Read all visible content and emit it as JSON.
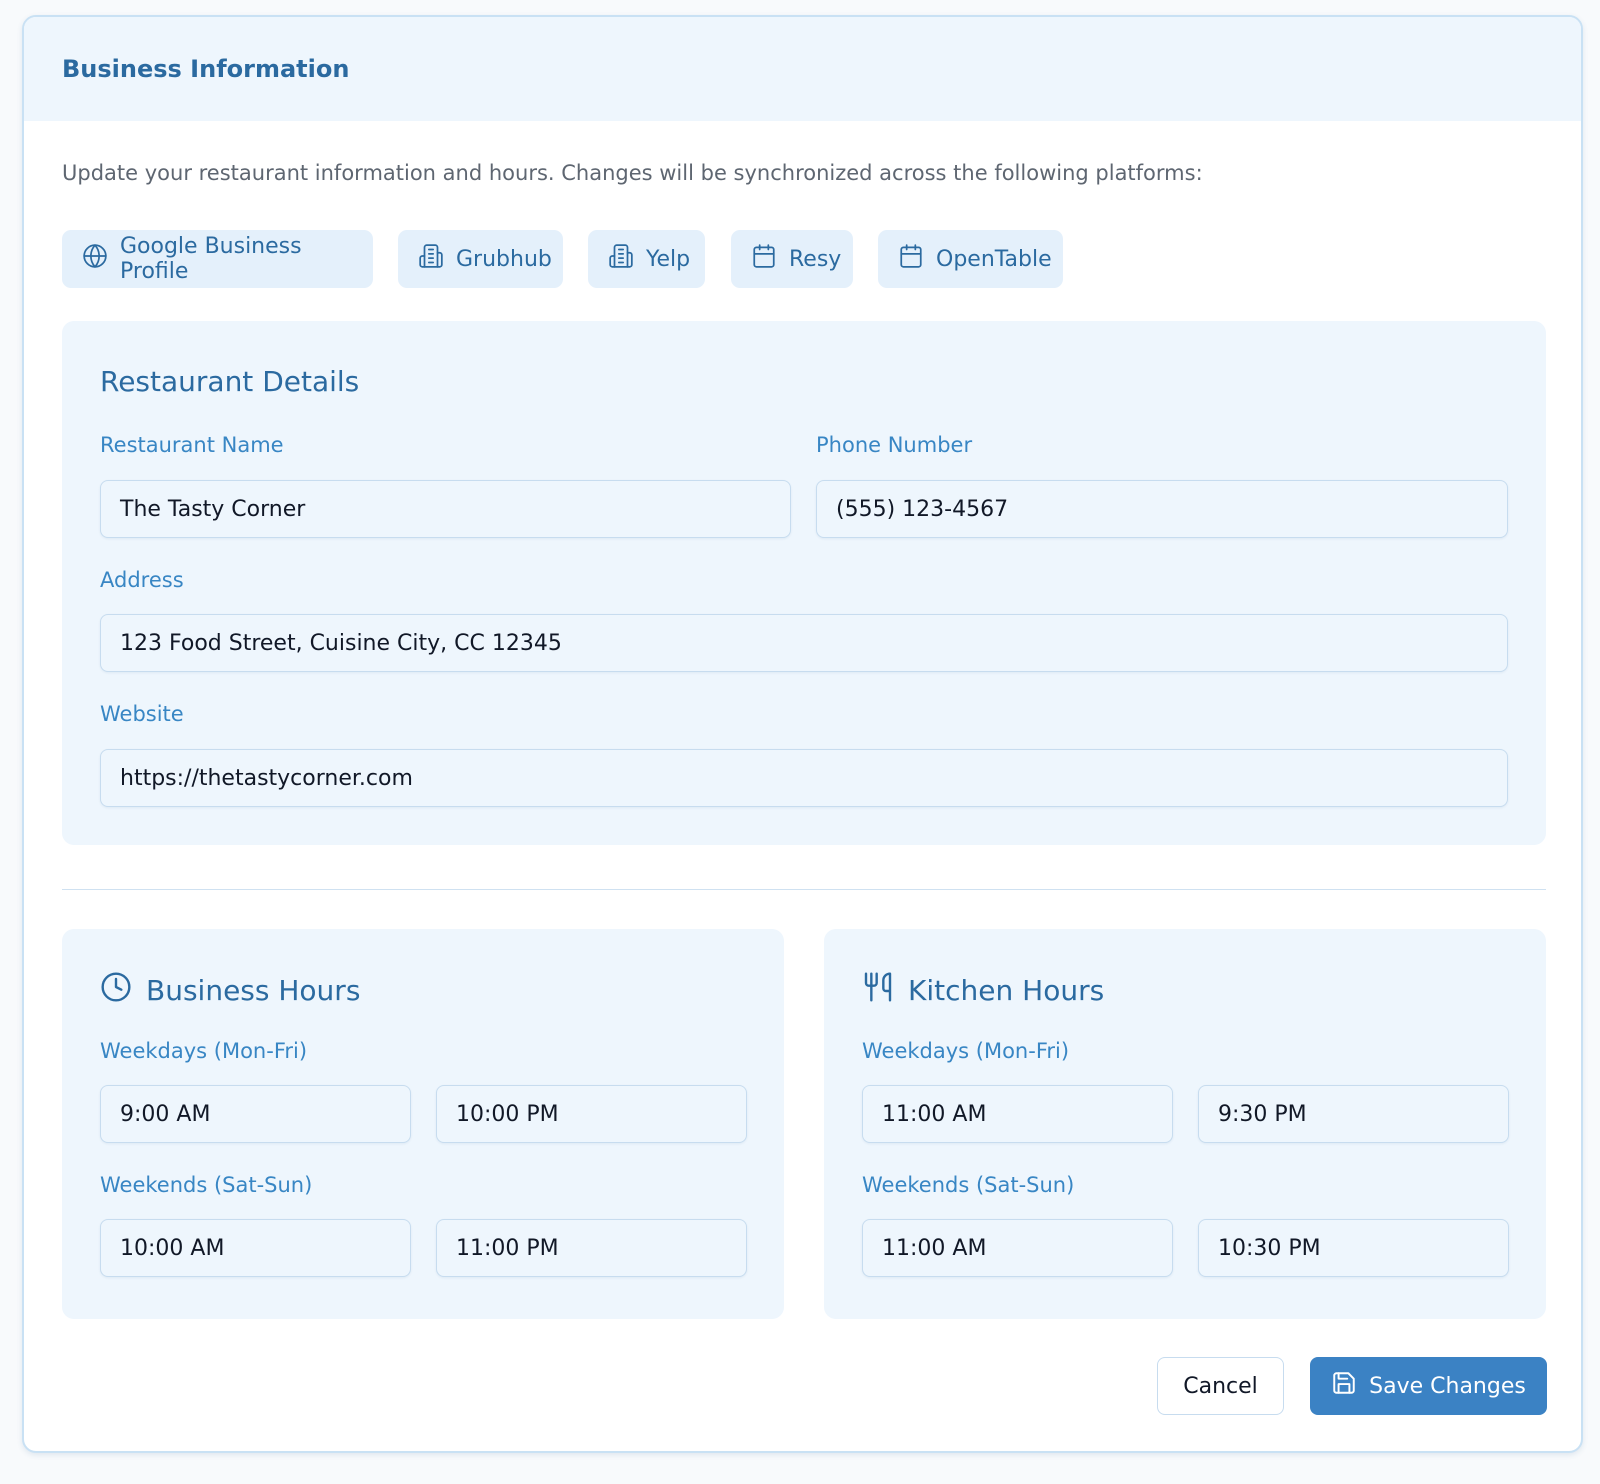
{
  "header": {
    "title": "Business Information"
  },
  "intro": "Update your restaurant information and hours. Changes will be synchronized across the following platforms:",
  "platforms": [
    {
      "label": "Google Business Profile",
      "icon": "globe-icon"
    },
    {
      "label": "Grubhub",
      "icon": "building-icon"
    },
    {
      "label": "Yelp",
      "icon": "building-icon"
    },
    {
      "label": "Resy",
      "icon": "calendar-icon"
    },
    {
      "label": "OpenTable",
      "icon": "calendar-icon"
    }
  ],
  "details": {
    "title": "Restaurant Details",
    "name_label": "Restaurant Name",
    "name_value": "The Tasty Corner",
    "phone_label": "Phone Number",
    "phone_value": "(555) 123-4567",
    "address_label": "Address",
    "address_value": "123 Food Street, Cuisine City, CC 12345",
    "website_label": "Website",
    "website_value": "https://thetastycorner.com"
  },
  "business_hours": {
    "title": "Business Hours",
    "icon": "clock-icon",
    "weekdays_label": "Weekdays (Mon-Fri)",
    "weekdays_open": "9:00 AM",
    "weekdays_close": "10:00 PM",
    "weekends_label": "Weekends (Sat-Sun)",
    "weekends_open": "10:00 AM",
    "weekends_close": "11:00 PM"
  },
  "kitchen_hours": {
    "title": "Kitchen Hours",
    "icon": "utensils-icon",
    "weekdays_label": "Weekdays (Mon-Fri)",
    "weekdays_open": "11:00 AM",
    "weekdays_close": "9:30 PM",
    "weekends_label": "Weekends (Sat-Sun)",
    "weekends_open": "11:00 AM",
    "weekends_close": "10:30 PM"
  },
  "actions": {
    "cancel_label": "Cancel",
    "save_label": "Save Changes",
    "save_icon": "save-icon"
  },
  "colors": {
    "accent": "#2b6aa0",
    "label": "#3886c4",
    "panel_bg": "#eef6fd",
    "chip_bg": "#e4f0fb",
    "primary_button": "#3b82c4"
  }
}
